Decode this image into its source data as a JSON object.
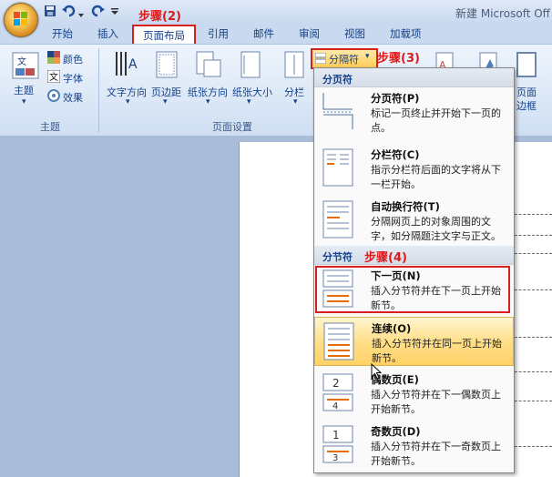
{
  "window": {
    "title": "新建 Microsoft Off",
    "quick_access": [
      "save-icon",
      "undo-icon",
      "redo-icon",
      "customize-icon"
    ]
  },
  "tabs": [
    "开始",
    "插入",
    "页面布局",
    "引用",
    "邮件",
    "审阅",
    "视图",
    "加载项"
  ],
  "active_tab": "页面布局",
  "ribbon": {
    "theme_group": {
      "label": "主题",
      "theme_button": "主题",
      "colors": "颜色",
      "fonts": "字体",
      "effects": "效果"
    },
    "page_setup_group": {
      "label": "页面设置",
      "text_direction": "文字方向",
      "margins": "页边距",
      "orientation": "纸张方向",
      "size": "纸张大小",
      "columns": "分栏",
      "breaks": "分隔符"
    },
    "right_partial": [
      "页面",
      "边框"
    ]
  },
  "annotations": {
    "step2": "步骤(2)",
    "step3": "步骤(3)",
    "step4": "步骤(4)"
  },
  "breaks_menu": {
    "page_breaks_header": "分页符",
    "section_breaks_header": "分节符",
    "items": [
      {
        "title": "分页符(P)",
        "desc": "标记一页终止并开始下一页的点。",
        "icon": "page-break-icon"
      },
      {
        "title": "分栏符(C)",
        "desc": "指示分栏符后面的文字将从下一栏开始。",
        "icon": "column-break-icon"
      },
      {
        "title": "自动换行符(T)",
        "desc": "分隔网页上的对象周围的文字，如分隔题注文字与正文。",
        "icon": "text-wrapping-break-icon"
      },
      {
        "title": "下一页(N)",
        "desc": "插入分节符并在下一页上开始新节。",
        "icon": "next-page-icon"
      },
      {
        "title": "连续(O)",
        "desc": "插入分节符并在同一页上开始新节。",
        "icon": "continuous-icon"
      },
      {
        "title": "偶数页(E)",
        "desc": "插入分节符并在下一偶数页上开始新节。",
        "icon": "even-page-icon"
      },
      {
        "title": "奇数页(D)",
        "desc": "插入分节符并在下一奇数页上开始新节。",
        "icon": "odd-page-icon"
      }
    ]
  },
  "colors": {
    "annotation_red": "#e01818",
    "ribbon_text": "#15428b",
    "highlight": "#ffd266"
  }
}
